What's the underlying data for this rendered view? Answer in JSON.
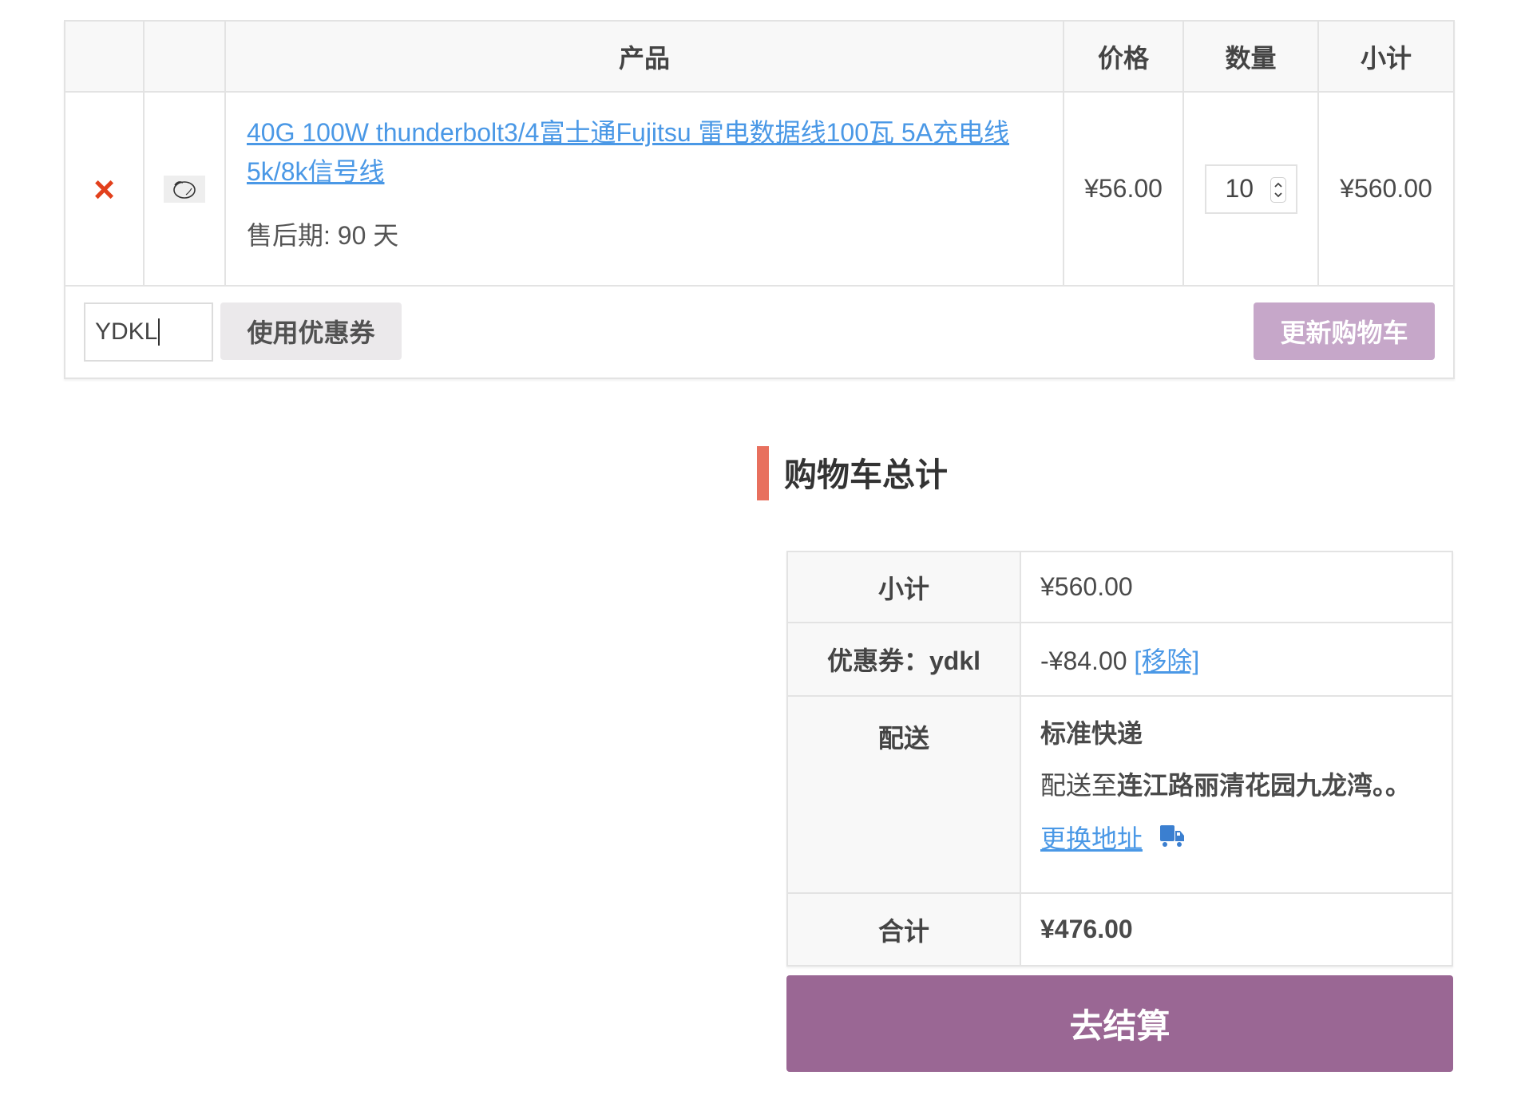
{
  "cart": {
    "headers": {
      "remove": "",
      "thumbnail": "",
      "product": "产品",
      "price": "价格",
      "quantity": "数量",
      "subtotal": "小计"
    },
    "item": {
      "remove_symbol": "×",
      "remove_icon": "close-icon",
      "thumbnail_icon": "cable-thumbnail",
      "name": "40G 100W thunderbolt3/4富士通Fujitsu 雷电数据线100瓦 5A充电线 5k/8k信号线",
      "meta": "售后期: 90 天",
      "price": "¥56.00",
      "quantity": "10",
      "subtotal": "¥560.00"
    },
    "coupon": {
      "input_value": "YDKL",
      "apply_label": "使用优惠券",
      "update_label": "更新购物车"
    }
  },
  "totals": {
    "title": "购物车总计",
    "subtotal_label": "小计",
    "subtotal_value": "¥560.00",
    "coupon_label": "优惠券：ydkl",
    "coupon_value": "-¥84.00",
    "coupon_remove": "[移除]",
    "shipping_label": "配送",
    "shipping_method": "标准快递",
    "shipping_dest_prefix": "配送至",
    "shipping_dest_address": "连江路丽清花园九龙湾。。",
    "shipping_change": "更换地址",
    "shipping_icon": "truck-icon",
    "total_label": "合计",
    "total_value": "¥476.00"
  },
  "checkout_label": "去结算",
  "colors": {
    "link": "#4a98e6",
    "remove": "#e2401c",
    "checkout": "#9a6794",
    "update_button": "#c6a7c9",
    "title_bar": "#e8705e"
  }
}
